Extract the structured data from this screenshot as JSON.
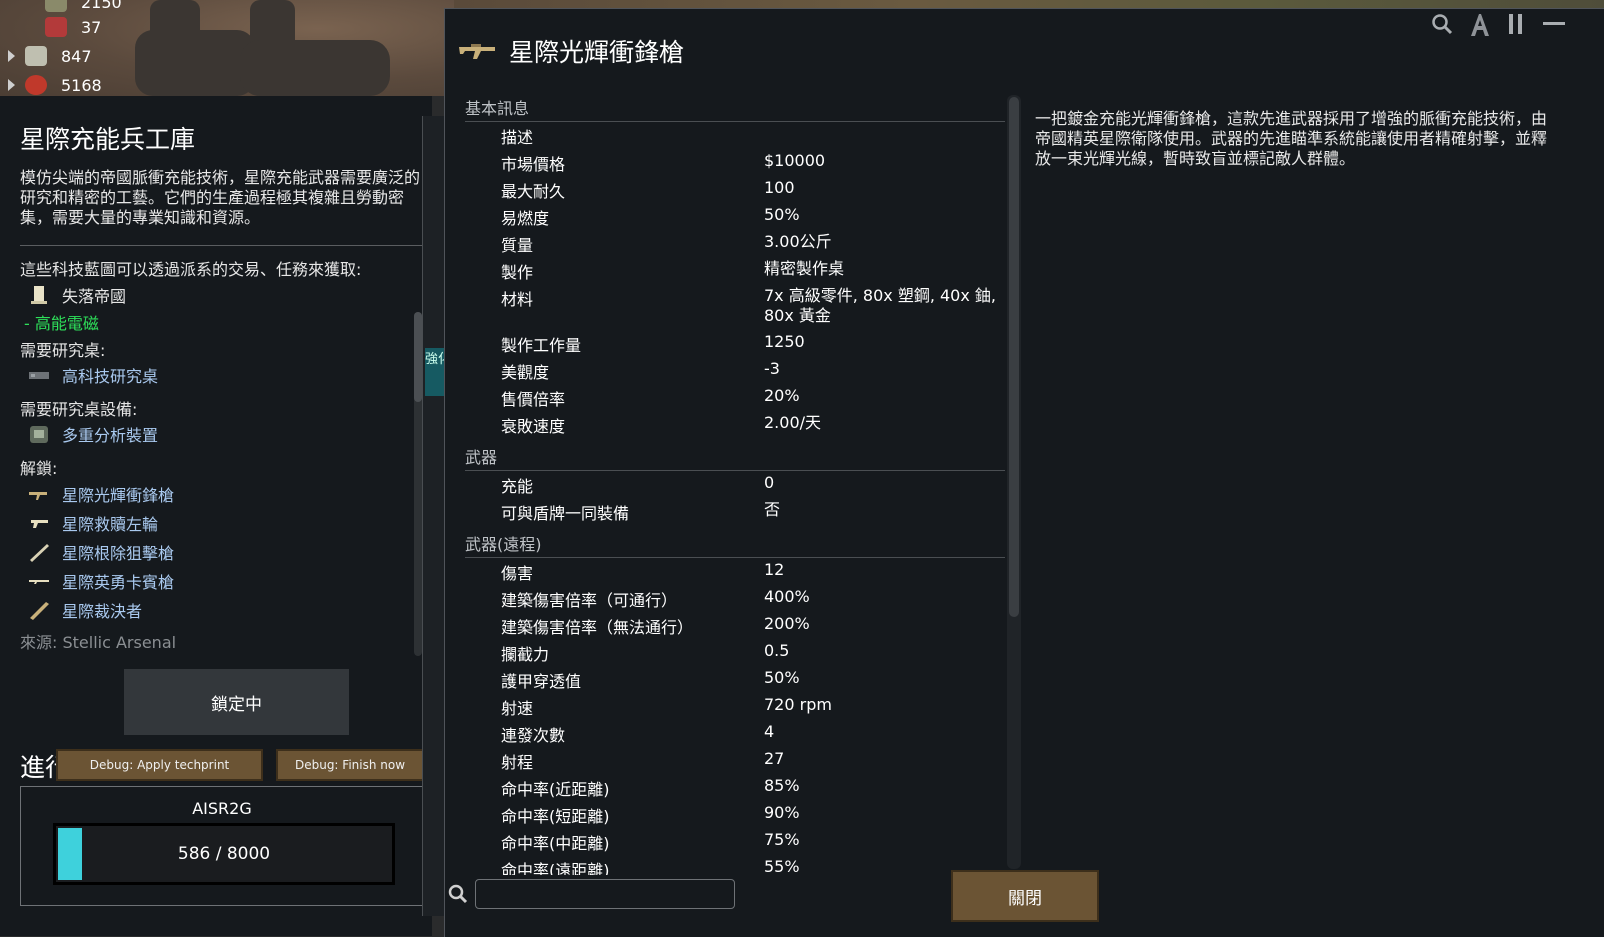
{
  "resources": [
    {
      "value": "2150",
      "icon": "stack-icon"
    },
    {
      "value": "37",
      "icon": "books-icon"
    },
    {
      "value": "847",
      "icon": "silver-icon"
    },
    {
      "value": "5168",
      "icon": "plant-icon"
    }
  ],
  "research": {
    "title": "星際充能兵工庫",
    "description": "模仿尖端的帝國脈衝充能技術，星際充能武器需要廣泛的研究和精密的工藝。它們的生產過程極其複雜且勞動密集，需要大量的專業知識和資源。",
    "techprint_intro": "這些科技藍圖可以透過派系的交易、任務來獲取:",
    "faction": "失落帝國",
    "faction_sub": "- 高能電磁",
    "bench_label": "需要研究桌:",
    "bench": "高科技研究桌",
    "facility_label": "需要研究桌設備:",
    "facility": "多重分析裝置",
    "unlocks_label": "解鎖:",
    "unlocks": [
      "星際光輝衝鋒槍",
      "星際救贖左輪",
      "星際根除狙擊槍",
      "星際英勇卡賓槍",
      "星際裁決者"
    ],
    "source": "來源:  Stellic Arsenal",
    "locked_label": "鎖定中",
    "progress_title": "進行",
    "debug_apply": "Debug: Apply techprint",
    "debug_finish": "Debug: Finish now",
    "project_name": "AISR2G",
    "progress_text": "586 / 8000",
    "progress_fraction": 0.0733,
    "behind_tab": "強化"
  },
  "card": {
    "title": "星際光輝衝鋒槍",
    "description": "一把鍍金充能光輝衝鋒槍，這款先進武器採用了增強的脈衝充能技術，由帝國精英星際衛隊使用。武器的先進瞄準系統能讓使用者精確射擊，並釋放一束光輝光線，暫時致盲並標記敵人群體。",
    "close_label": "關閉",
    "sections": [
      {
        "header": "基本訊息",
        "rows": [
          {
            "label": "描述",
            "value": ""
          },
          {
            "label": "市場價格",
            "value": "$10000"
          },
          {
            "label": "最大耐久",
            "value": "100"
          },
          {
            "label": "易燃度",
            "value": "50%"
          },
          {
            "label": "質量",
            "value": "3.00公斤"
          },
          {
            "label": "製作",
            "value": "精密製作桌"
          },
          {
            "label": "材料",
            "value": "7x 高級零件, 80x 塑鋼, 40x 鈾, 80x 黃金"
          },
          {
            "label": "製作工作量",
            "value": "1250"
          },
          {
            "label": "美觀度",
            "value": "-3"
          },
          {
            "label": "售價倍率",
            "value": "20%"
          },
          {
            "label": "衰敗速度",
            "value": "2.00/天"
          }
        ]
      },
      {
        "header": "武器",
        "rows": [
          {
            "label": "充能",
            "value": "0"
          },
          {
            "label": "可與盾牌一同裝備",
            "value": "否"
          }
        ]
      },
      {
        "header": "武器(遠程)",
        "rows": [
          {
            "label": "傷害",
            "value": "12"
          },
          {
            "label": "建築傷害倍率（可通行）",
            "value": "400%"
          },
          {
            "label": "建築傷害倍率（無法通行）",
            "value": "200%"
          },
          {
            "label": "攔截力",
            "value": "0.5"
          },
          {
            "label": "護甲穿透值",
            "value": "50%"
          },
          {
            "label": "射速",
            "value": "720 rpm"
          },
          {
            "label": "連發次數",
            "value": "4"
          },
          {
            "label": "射程",
            "value": "27"
          },
          {
            "label": "命中率(近距離)",
            "value": "85%"
          },
          {
            "label": "命中率(短距離)",
            "value": "90%"
          },
          {
            "label": "命中率(中距離)",
            "value": "75%"
          },
          {
            "label": "命中率(遠距離)",
            "value": "55%"
          }
        ]
      }
    ]
  },
  "colors": {
    "accent_cyan": "#3ed1dc",
    "link_blue": "#a9c9ef",
    "green": "#2ee05a",
    "button_brown": "#6b5434"
  }
}
